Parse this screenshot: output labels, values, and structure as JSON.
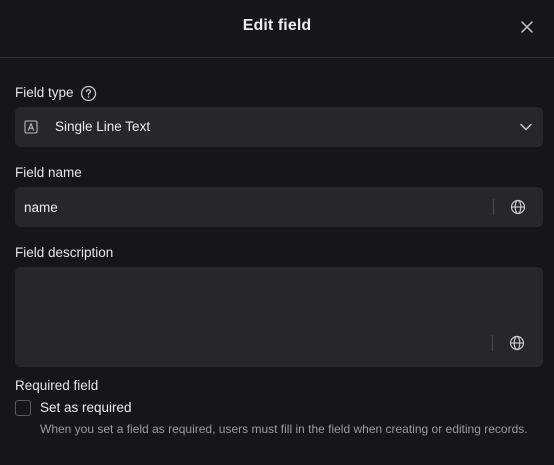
{
  "dialog": {
    "title": "Edit field",
    "close_icon": "close-icon"
  },
  "field_type": {
    "label": "Field type",
    "help_icon": "question-circle-icon",
    "type_icon": "text-type-icon",
    "selected": "Single Line Text",
    "chevron_icon": "chevron-down-icon"
  },
  "field_name": {
    "label": "Field name",
    "value": "name",
    "locale_icon": "globe-icon"
  },
  "field_description": {
    "label": "Field description",
    "value": "",
    "locale_icon": "globe-icon"
  },
  "required": {
    "label": "Required field",
    "checkbox_label": "Set as required",
    "checked": false,
    "help_text": "When you set a field as required, users must fill in the field when creating or editing records."
  },
  "colors": {
    "background": "#161618",
    "input_background": "#27272a",
    "text": "#ececee",
    "muted_text": "#9a9aa0",
    "border": "#2e2e32"
  }
}
